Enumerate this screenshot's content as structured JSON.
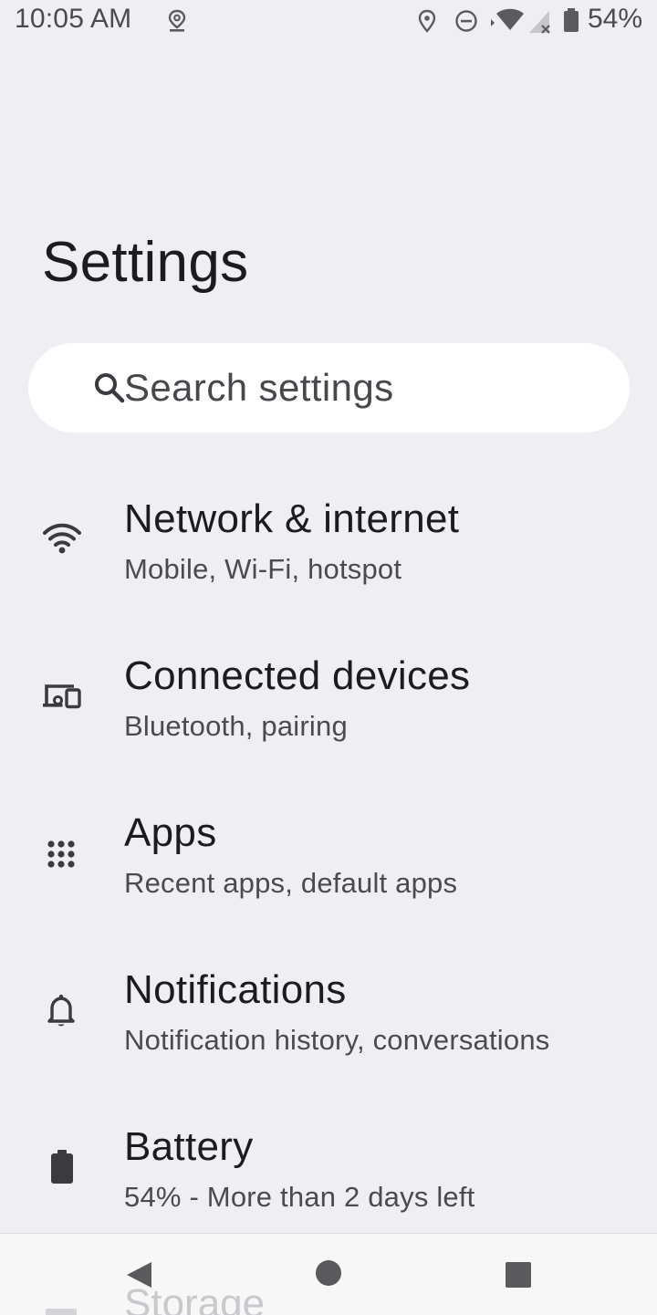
{
  "status_bar": {
    "time": "10:05 AM",
    "battery_percent": "54%",
    "icons": [
      "location-pin-outline-icon",
      "location-icon",
      "do-not-disturb-icon",
      "wifi-icon",
      "cell-signal-icon",
      "battery-icon"
    ]
  },
  "header": {
    "title": "Settings"
  },
  "search": {
    "placeholder": "Search settings",
    "icon": "search-icon"
  },
  "settings": {
    "items": [
      {
        "icon": "wifi-icon",
        "title": "Network & internet",
        "summary": "Mobile, Wi‑Fi, hotspot"
      },
      {
        "icon": "connected-devices-icon",
        "title": "Connected devices",
        "summary": "Bluetooth, pairing"
      },
      {
        "icon": "apps-grid-icon",
        "title": "Apps",
        "summary": "Recent apps, default apps"
      },
      {
        "icon": "bell-icon",
        "title": "Notifications",
        "summary": "Notification history, conversations"
      },
      {
        "icon": "battery-icon",
        "title": "Battery",
        "summary": "54% - More than 2 days left"
      },
      {
        "icon": "storage-icon",
        "title": "Storage",
        "summary": ""
      }
    ]
  },
  "navigation": {
    "buttons": [
      "back-icon",
      "home-icon",
      "recents-icon"
    ]
  },
  "colors": {
    "background": "#efeff3",
    "surface": "#ffffff",
    "text_primary": "#1c1c20",
    "text_secondary": "#4a4a50",
    "icon": "#3a3a3f"
  }
}
